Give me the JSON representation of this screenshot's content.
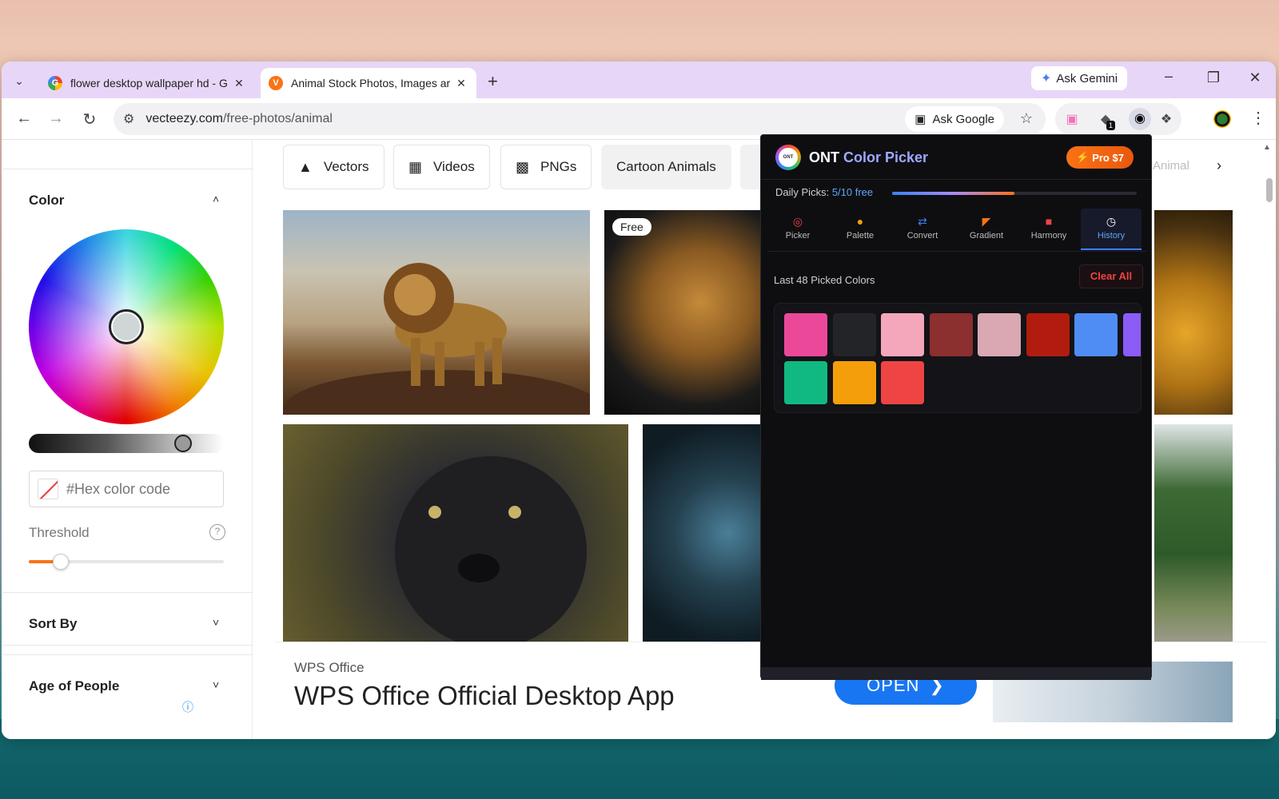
{
  "browser": {
    "tabs": [
      {
        "title": "flower desktop wallpaper hd - G",
        "active": false,
        "favicon": "google-icon"
      },
      {
        "title": "Animal Stock Photos, Images ar",
        "active": true,
        "favicon": "vecteezy-icon"
      }
    ],
    "gemini_label": "Ask Gemini",
    "url_domain": "vecteezy.com",
    "url_path": "/free-photos/animal",
    "ask_google_label": "Ask Google",
    "extension_badge": "1"
  },
  "sidebar": {
    "color_heading": "Color",
    "hex_placeholder": "#Hex color code",
    "threshold_label": "Threshold",
    "threshold_value": 0.12,
    "lightness_value": 0.78,
    "sort_by_heading": "Sort By",
    "age_heading": "Age of People"
  },
  "content": {
    "chips": [
      "Vectors",
      "Videos",
      "PNGs",
      "Cartoon Animals"
    ],
    "chip_partial": "Animal",
    "free_badge": "Free"
  },
  "ad": {
    "brand": "WPS Office",
    "title": "WPS Office Official Desktop App",
    "cta": "OPEN"
  },
  "color_picker": {
    "title_brand": "ONT",
    "title_name": "Color Picker",
    "pro_label": "Pro $7",
    "daily_label": "Daily Picks:",
    "daily_value": "5/10 free",
    "daily_fraction": 0.5,
    "tabs": [
      {
        "label": "Picker",
        "icon": "target-icon",
        "active": false
      },
      {
        "label": "Palette",
        "icon": "palette-icon",
        "active": false
      },
      {
        "label": "Convert",
        "icon": "convert-icon",
        "active": false
      },
      {
        "label": "Gradient",
        "icon": "rainbow-icon",
        "active": false
      },
      {
        "label": "Harmony",
        "icon": "harmony-icon",
        "active": false
      },
      {
        "label": "History",
        "icon": "clock-icon",
        "active": true
      }
    ],
    "history_label": "Last 48 Picked Colors",
    "clear_label": "Clear All",
    "swatches": [
      "#ec4899",
      "#232428",
      "#f4a7bb",
      "#8b2f2f",
      "#d9a8b2",
      "#b11c0e",
      "#4f8df5",
      "#8b5cf6",
      "#10b981",
      "#f59e0b",
      "#ef4444"
    ]
  }
}
